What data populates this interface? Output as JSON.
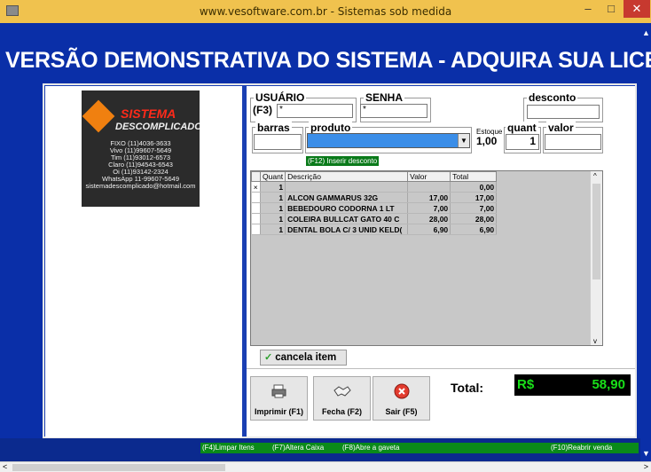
{
  "window": {
    "title": "www.vesoftware.com.br  -  Sistemas sob medida",
    "minimize": "–",
    "maximize": "□",
    "close": "✕"
  },
  "banner": "VERSÃO DEMONSTRATIVA DO SISTEMA - ADQUIRA SUA LICE",
  "logo": {
    "line1": "SISTEMA",
    "line2": "DESCOMPLICADO",
    "contacts": [
      "FIXO (11)4036-3633",
      "Vivo (11)99607-5649",
      "Tim (11)93012-6573",
      "Claro (11)94543-6543",
      "Oi (11)93142-2324",
      "WhatsApp 11-99607-5649",
      "sistemadescomplicado@hotmail.com"
    ]
  },
  "form": {
    "usuario_label": "USUÁRIO",
    "usuario_prefix": "(F3)",
    "usuario_value": "*",
    "senha_label": "SENHA",
    "senha_value": "*",
    "desconto_label": "desconto",
    "desconto_value": "",
    "barras_label": "barras",
    "barras_value": "",
    "produto_label": "produto",
    "produto_value": "",
    "estoque_label": "Estoque",
    "estoque_value": "1,00",
    "quant_label": "quant",
    "quant_value": "1",
    "valor_label": "valor",
    "valor_value": "",
    "f12_hint": "(F12) Inserir desconto"
  },
  "grid": {
    "columns": [
      "Quant",
      "Descrição",
      "Valor",
      "Total"
    ],
    "rows": [
      {
        "indicator": "×",
        "quant": "1",
        "descricao": "",
        "valor": "",
        "total": "0,00"
      },
      {
        "indicator": "",
        "quant": "1",
        "descricao": "ALCON GAMMARUS 32G",
        "valor": "17,00",
        "total": "17,00"
      },
      {
        "indicator": "",
        "quant": "1",
        "descricao": "BEBEDOURO CODORNA 1 LT",
        "valor": "7,00",
        "total": "7,00"
      },
      {
        "indicator": "",
        "quant": "1",
        "descricao": "COLEIRA  BULLCAT GATO 40 C",
        "valor": "28,00",
        "total": "28,00"
      },
      {
        "indicator": "",
        "quant": "1",
        "descricao": "DENTAL BOLA C/ 3 UNID KELD(",
        "valor": "6,90",
        "total": "6,90"
      }
    ]
  },
  "actions": {
    "cancela": "cancela item",
    "imprimir": "Imprimir (F1)",
    "fecha": "Fecha (F2)",
    "sair": "Sair (F5)"
  },
  "total": {
    "label": "Total:",
    "currency": "R$",
    "amount": "58,90"
  },
  "status": {
    "limpar": "(F4)Limpar Itens",
    "altera": "(F7)Altera Caixa",
    "gaveta": "(F8)Abre a gaveta",
    "reabrir": "(F10)Reabrir venda"
  }
}
